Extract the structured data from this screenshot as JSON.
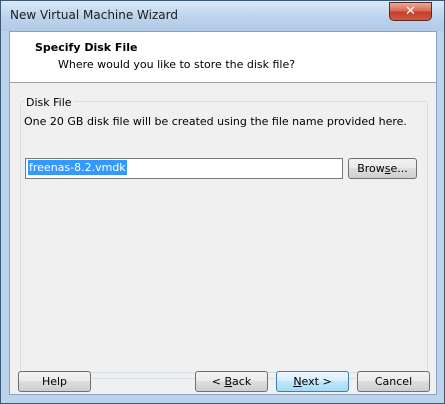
{
  "window": {
    "title": "New Virtual Machine Wizard",
    "close_glyph": "✕"
  },
  "header": {
    "title": "Specify Disk File",
    "subtitle": "Where would you like to store the disk file?"
  },
  "disk_file": {
    "group_label": "Disk File",
    "description": "One 20 GB disk file will be created using the file name provided here.",
    "file_name": "freenas-8.2.vmdk",
    "browse": {
      "pre": "Brow",
      "accel": "s",
      "post": "e..."
    }
  },
  "buttons": {
    "help": "Help",
    "back": {
      "pre": "< ",
      "accel": "B",
      "post": "ack"
    },
    "next": {
      "accel": "N",
      "post": "ext >"
    },
    "cancel": "Cancel"
  },
  "colors": {
    "selection": "#3399ff",
    "close_button": "#c4402b",
    "title_bar": "#bcd3ec"
  }
}
